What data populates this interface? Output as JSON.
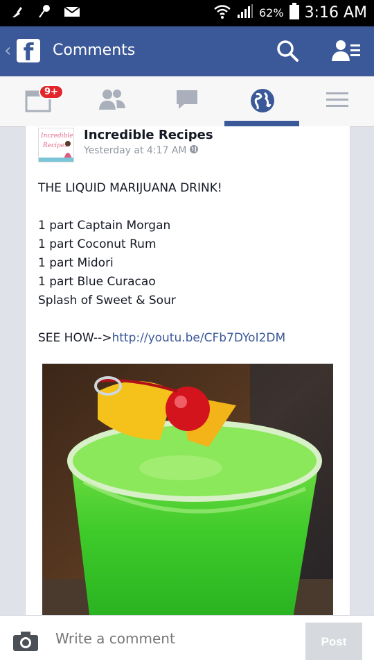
{
  "status_bar": {
    "battery": "62%",
    "time": "3:16 AM"
  },
  "header": {
    "title": "Comments",
    "back_glyph": "‹",
    "logo_letter": "f"
  },
  "nav": {
    "badge": "9+"
  },
  "post": {
    "page_name": "Incredible Recipes",
    "timestamp": "Yesterday at 4:17 AM",
    "avatar_text": "Incredible Recipes",
    "headline": "THE LIQUID MARIJUANA DRINK!",
    "ingredients": "1 part Captain Morgan\n1 part Coconut Rum\n1 part Midori\n1 part Blue Curacao\nSplash of Sweet & Sour",
    "see_how": "SEE HOW-->",
    "link": "http://youtu.be/CFb7DYoI2DM"
  },
  "comment_bar": {
    "placeholder": "Write a comment",
    "post_label": "Post"
  },
  "colors": {
    "facebook_blue": "#3b5998",
    "badge_red": "#e3252c"
  }
}
